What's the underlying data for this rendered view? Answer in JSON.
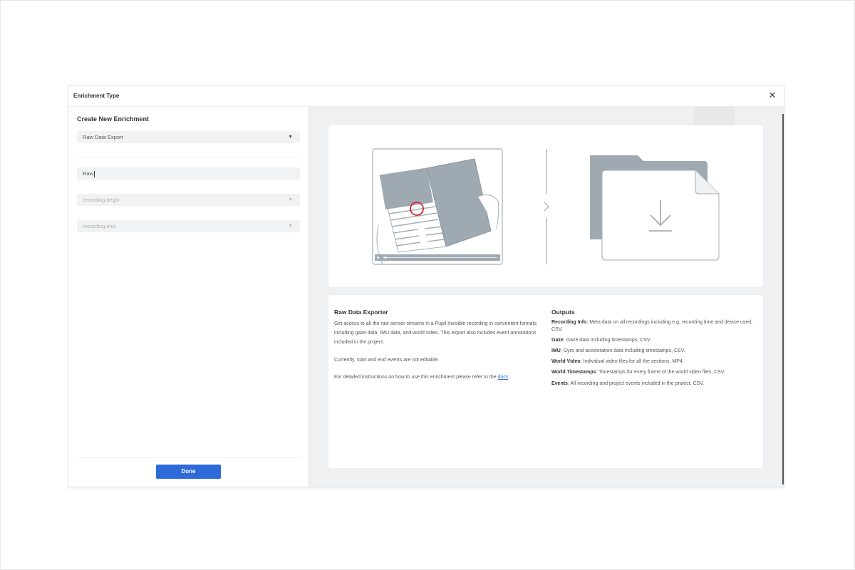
{
  "dialog": {
    "title": "Enrichment Type",
    "close_symbol": "✕"
  },
  "form": {
    "heading": "Create New Enrichment",
    "enrichment_type": "Raw Data Export",
    "name_value": "Raw",
    "start_event_placeholder": "recording.begin",
    "end_event_placeholder": "recording.end",
    "done_label": "Done"
  },
  "info": {
    "title": "Raw Data Exporter",
    "description": "Get access to all the raw sensor streams in a Pupil Invisible recording in convenient formats including gaze data, IMU data, and world video. This export also includes event annotations included in the project.",
    "note": "Currently, start and end events are not editable.",
    "docs_prefix": "For detailed instructions on how to use this enrichment please refer to the ",
    "docs_link": "docs",
    "docs_suffix": "."
  },
  "outputs": {
    "title": "Outputs",
    "items": [
      {
        "name": "Recording Info",
        "desc": ": Meta data on all recordings including e.g. recording time and device used, CSV."
      },
      {
        "name": "Gaze",
        "desc": ": Gaze data including timestamps, CSV."
      },
      {
        "name": "IMU",
        "desc": ": Gyro and acceleration data including timestamps, CSV."
      },
      {
        "name": "World Video",
        "desc": ": Individual video files for all the sections, MP4."
      },
      {
        "name": "World Timestamps",
        "desc": ": Timestamps for every frame of the world video files, CSV."
      },
      {
        "name": "Events",
        "desc": ": All recording and project events included in the project, CSV."
      }
    ]
  },
  "icons": {
    "caret": "▼",
    "chevron": "›"
  },
  "colors": {
    "primary": "#2f6bd8",
    "gaze_circle": "#d9262c",
    "illustration_fill": "#9ea9b1"
  }
}
